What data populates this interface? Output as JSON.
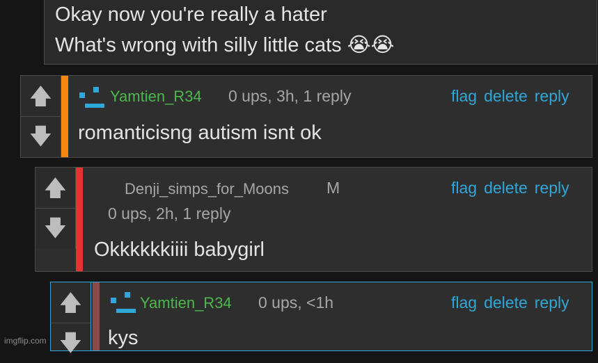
{
  "top_comment": {
    "line1": "Okay now you're really a hater",
    "line2": "What's wrong with silly little cats 😭😭"
  },
  "comments": [
    {
      "username": "Yamtien_R34",
      "meta": "0 ups, 3h, 1 reply",
      "body": "romanticisng autism isnt ok",
      "stripe_color": "#f6870f"
    },
    {
      "username": "Denji_simps_for_Moons",
      "badge": "M",
      "meta": "0 ups, 2h, 1 reply",
      "body": "Okkkkkkiiii babygirl",
      "stripe_color": "#e53333"
    },
    {
      "username": "Yamtien_R34",
      "meta": "0 ups, <1h",
      "body": "kys",
      "stripe_color": "#8b4b4b"
    }
  ],
  "actions": {
    "flag": "flag",
    "delete": "delete",
    "reply": "reply"
  },
  "watermark": "imgflip.com",
  "colors": {
    "link": "#2fa7d8",
    "username": "#4cb84c",
    "panel": "#2e2e2e"
  }
}
